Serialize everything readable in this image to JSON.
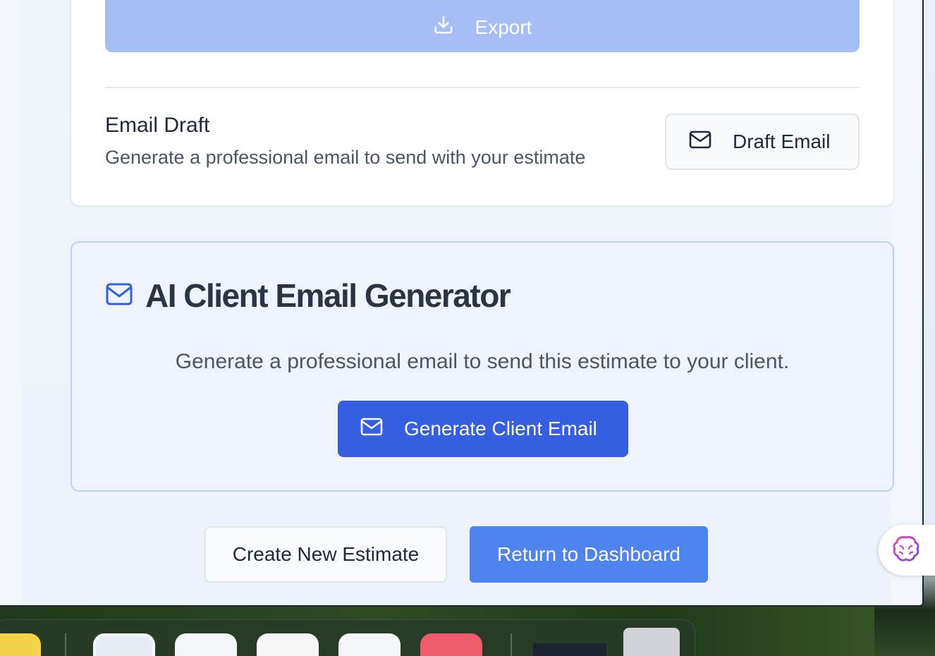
{
  "export_button": {
    "label": "Export",
    "icon": "download-icon"
  },
  "email_draft": {
    "title": "Email Draft",
    "description": "Generate a professional email to send with your estimate",
    "button_label": "Draft Email",
    "button_icon": "mail-icon"
  },
  "ai_generator": {
    "title": "AI Client Email Generator",
    "icon": "mail-icon",
    "description": "Generate a professional email to send this estimate to your client.",
    "button_label": "Generate Client Email",
    "button_icon": "mail-icon"
  },
  "actions": {
    "create_label": "Create New Estimate",
    "return_label": "Return to Dashboard"
  },
  "assistant_fab": {
    "icon": "brain-icon"
  },
  "dock": {
    "items": [
      "notes-icon",
      "finder-icon",
      "word-icon",
      "textedit-icon",
      "excel-icon",
      "music-icon",
      "screenshot-thumbnail",
      "trash-icon"
    ]
  },
  "colors": {
    "primary": "#355fe0",
    "secondary_primary": "#4f84f0",
    "export_disabled": "#a5bff5",
    "panel_bg": "#eef3fd",
    "panel_border": "#bcd3f5"
  }
}
